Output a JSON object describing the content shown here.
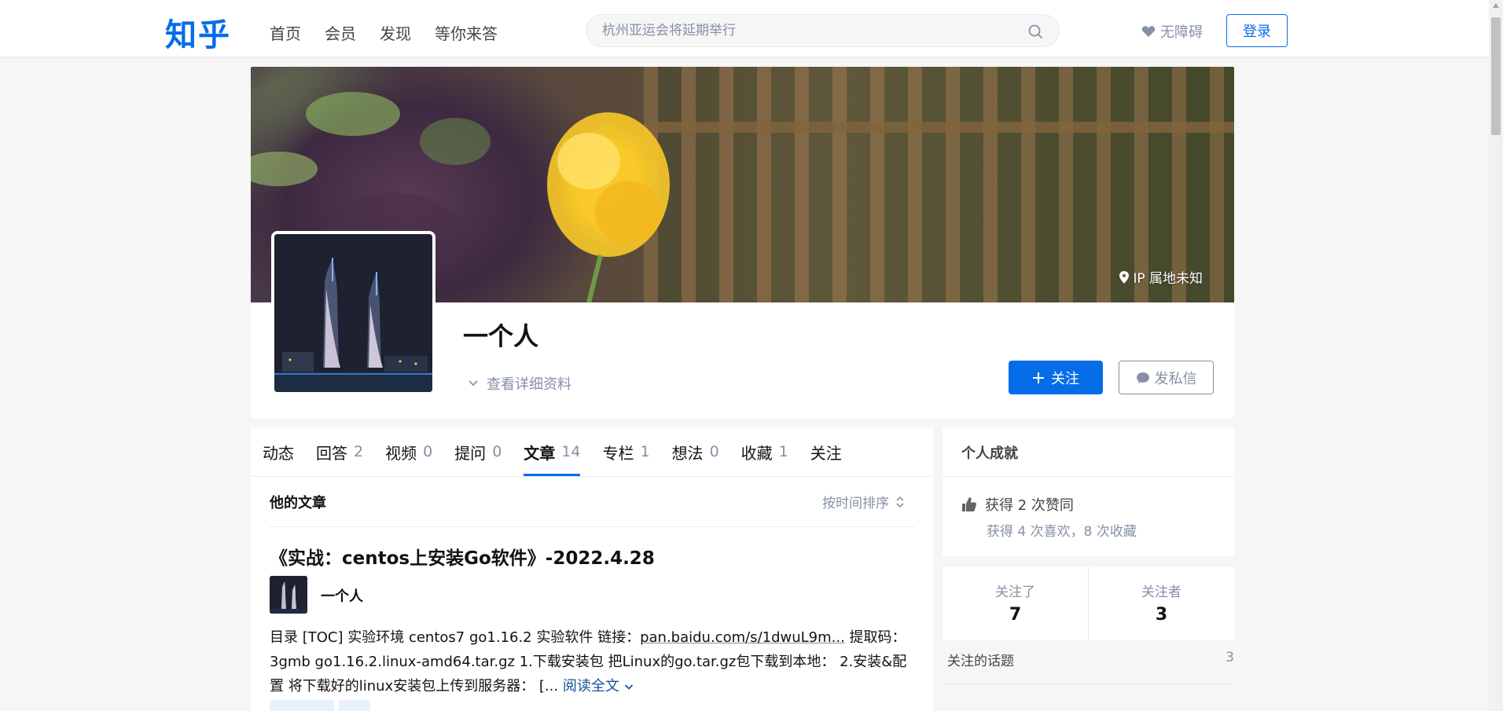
{
  "header": {
    "logo": "知乎",
    "nav": [
      "首页",
      "会员",
      "发现",
      "等你来答"
    ],
    "search_placeholder": "杭州亚运会将延期举行",
    "accessibility_label": "无障碍",
    "login_label": "登录"
  },
  "profile": {
    "ip_location": "IP 属地未知",
    "name": "一个人",
    "details_label": "查看详细资料",
    "follow_label": "关注",
    "message_label": "发私信"
  },
  "tabs": [
    {
      "label": "动态",
      "count": ""
    },
    {
      "label": "回答",
      "count": "2"
    },
    {
      "label": "视频",
      "count": "0"
    },
    {
      "label": "提问",
      "count": "0"
    },
    {
      "label": "文章",
      "count": "14"
    },
    {
      "label": "专栏",
      "count": "1"
    },
    {
      "label": "想法",
      "count": "0"
    },
    {
      "label": "收藏",
      "count": "1"
    },
    {
      "label": "关注",
      "count": ""
    }
  ],
  "active_tab": 4,
  "articles_section": {
    "title": "他的文章",
    "sort_label": "按时间排序"
  },
  "article": {
    "title": "《实战：centos上安装Go软件》-2022.4.28",
    "author": "一个人",
    "excerpt_pre": "目录 [TOC] 实验环境 centos7 go1.16.2 实验软件 链接：",
    "excerpt_link": "pan.baidu.com/s/1dwuL9m...",
    "excerpt_post": " 提取码：3gmb go1.16.2.linux-amd64.tar.gz 1.下载安装包 把Linux的go.tar.gz包下载到本地： 2.安装&配置 将下载好的linux安装包上传到服务器： [...",
    "read_more": "阅读全文"
  },
  "achievements": {
    "title": "个人成就",
    "likes": "获得 2 次赞同",
    "sub": "获得 4 次喜欢，8 次收藏"
  },
  "stats": {
    "following_label": "关注了",
    "following_count": "7",
    "followers_label": "关注者",
    "followers_count": "3"
  },
  "topics": {
    "label": "关注的话题",
    "count": "3"
  },
  "colors": {
    "brand": "#056de8",
    "muted": "#8590a6",
    "link": "#175199"
  }
}
